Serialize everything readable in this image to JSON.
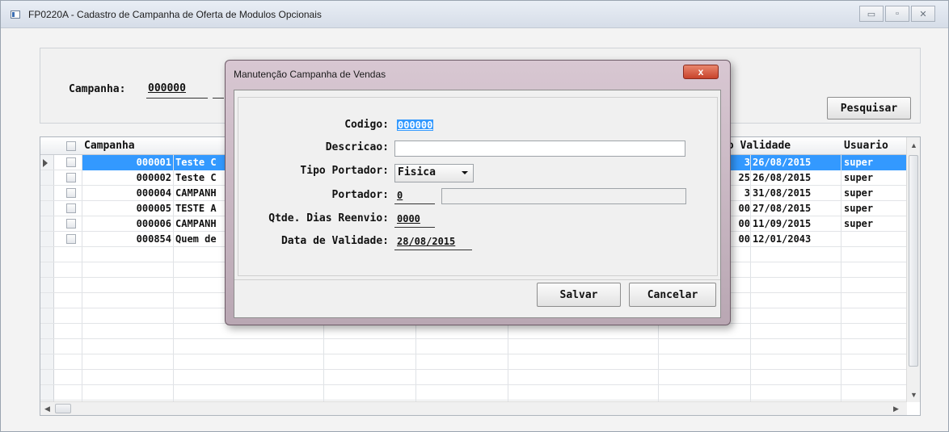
{
  "window": {
    "title": "FP0220A - Cadastro de Campanha de Oferta de Modulos Opcionais",
    "minimize": "▭",
    "maximize": "▫",
    "close": "✕"
  },
  "search": {
    "campanha_label": "Campanha:",
    "campanha_value": "000000",
    "pesquisar_label": "Pesquisar"
  },
  "grid": {
    "columns": {
      "campanha": "Campanha",
      "validade": "io Validade",
      "usuario": "Usuario"
    },
    "rows": [
      {
        "codigo": "000001",
        "descricao": "Teste C",
        "extra": "3",
        "validade": "26/08/2015",
        "usuario": "super",
        "selected": true
      },
      {
        "codigo": "000002",
        "descricao": "Teste C",
        "extra": "25",
        "validade": "26/08/2015",
        "usuario": "super"
      },
      {
        "codigo": "000004",
        "descricao": "CAMPANH",
        "extra": "3",
        "validade": "31/08/2015",
        "usuario": "super"
      },
      {
        "codigo": "000005",
        "descricao": "TESTE A",
        "extra": "00",
        "validade": "27/08/2015",
        "usuario": "super"
      },
      {
        "codigo": "000006",
        "descricao": "CAMPANH",
        "extra": "00",
        "validade": "11/09/2015",
        "usuario": "super"
      },
      {
        "codigo": "000854",
        "descricao": "Quem de",
        "extra": "00",
        "validade": "12/01/2043",
        "usuario": ""
      }
    ]
  },
  "dialog": {
    "title": "Manutenção Campanha de Vendas",
    "close": "x",
    "codigo_label": "Codigo:",
    "codigo_value": "000000",
    "descricao_label": "Descricao:",
    "descricao_value": "",
    "tipo_portador_label": "Tipo Portador:",
    "tipo_portador_value": "Fisica",
    "portador_label": "Portador:",
    "portador_value": "0",
    "portador_desc": "",
    "dias_reenvio_label": "Qtde. Dias Reenvio:",
    "dias_reenvio_value": "0000",
    "data_validade_label": "Data de Validade:",
    "data_validade_value": "28/08/2015",
    "salvar_label": "Salvar",
    "cancelar_label": "Cancelar"
  }
}
